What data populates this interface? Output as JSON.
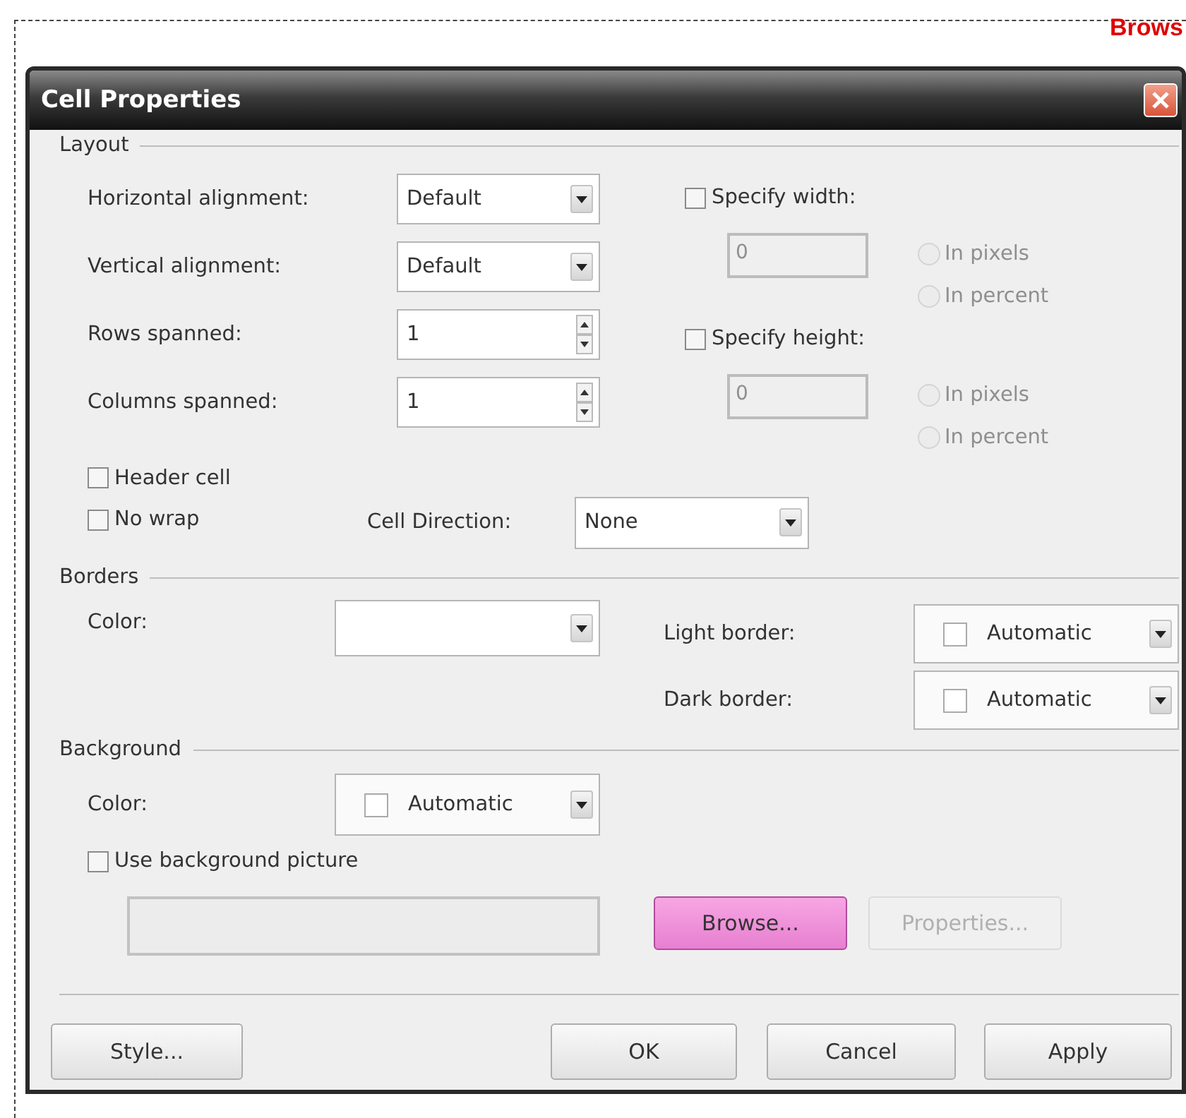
{
  "annotation": {
    "text": "Brows"
  },
  "window": {
    "title": "Cell Properties"
  },
  "layout": {
    "legend": "Layout",
    "horizontal_alignment": {
      "label": "Horizontal alignment:",
      "value": "Default"
    },
    "vertical_alignment": {
      "label": "Vertical alignment:",
      "value": "Default"
    },
    "rows_spanned": {
      "label": "Rows spanned:",
      "value": "1"
    },
    "columns_spanned": {
      "label": "Columns spanned:",
      "value": "1"
    },
    "specify_width": {
      "label": "Specify width:",
      "checked": false,
      "value": "0",
      "disabled": true,
      "options": [
        {
          "label": "In pixels",
          "selected": false,
          "disabled": true
        },
        {
          "label": "In percent",
          "selected": false,
          "disabled": true
        }
      ]
    },
    "specify_height": {
      "label": "Specify height:",
      "checked": false,
      "value": "0",
      "disabled": true,
      "options": [
        {
          "label": "In pixels",
          "selected": false,
          "disabled": true
        },
        {
          "label": "In percent",
          "selected": false,
          "disabled": true
        }
      ]
    },
    "header_cell": {
      "label": "Header cell",
      "checked": false
    },
    "no_wrap": {
      "label": "No wrap",
      "checked": false
    },
    "cell_direction": {
      "label": "Cell Direction:",
      "value": "None"
    }
  },
  "borders": {
    "legend": "Borders",
    "color": {
      "label": "Color:"
    },
    "light_border": {
      "label": "Light border:",
      "value": "Automatic"
    },
    "dark_border": {
      "label": "Dark border:",
      "value": "Automatic"
    }
  },
  "background": {
    "legend": "Background",
    "color": {
      "label": "Color:",
      "value": "Automatic"
    },
    "use_picture": {
      "label": "Use background picture",
      "checked": false
    },
    "buttons": [
      {
        "label": "Browse...",
        "highlighted": true,
        "disabled": false
      },
      {
        "label": "Properties...",
        "highlighted": false,
        "disabled": true
      }
    ]
  },
  "footer_buttons": [
    {
      "label": "Style...",
      "highlighted": false,
      "disabled": false
    },
    {
      "label": "OK",
      "highlighted": false,
      "disabled": false
    },
    {
      "label": "Cancel",
      "highlighted": false,
      "disabled": false
    },
    {
      "label": "Apply",
      "highlighted": false,
      "disabled": false
    }
  ]
}
